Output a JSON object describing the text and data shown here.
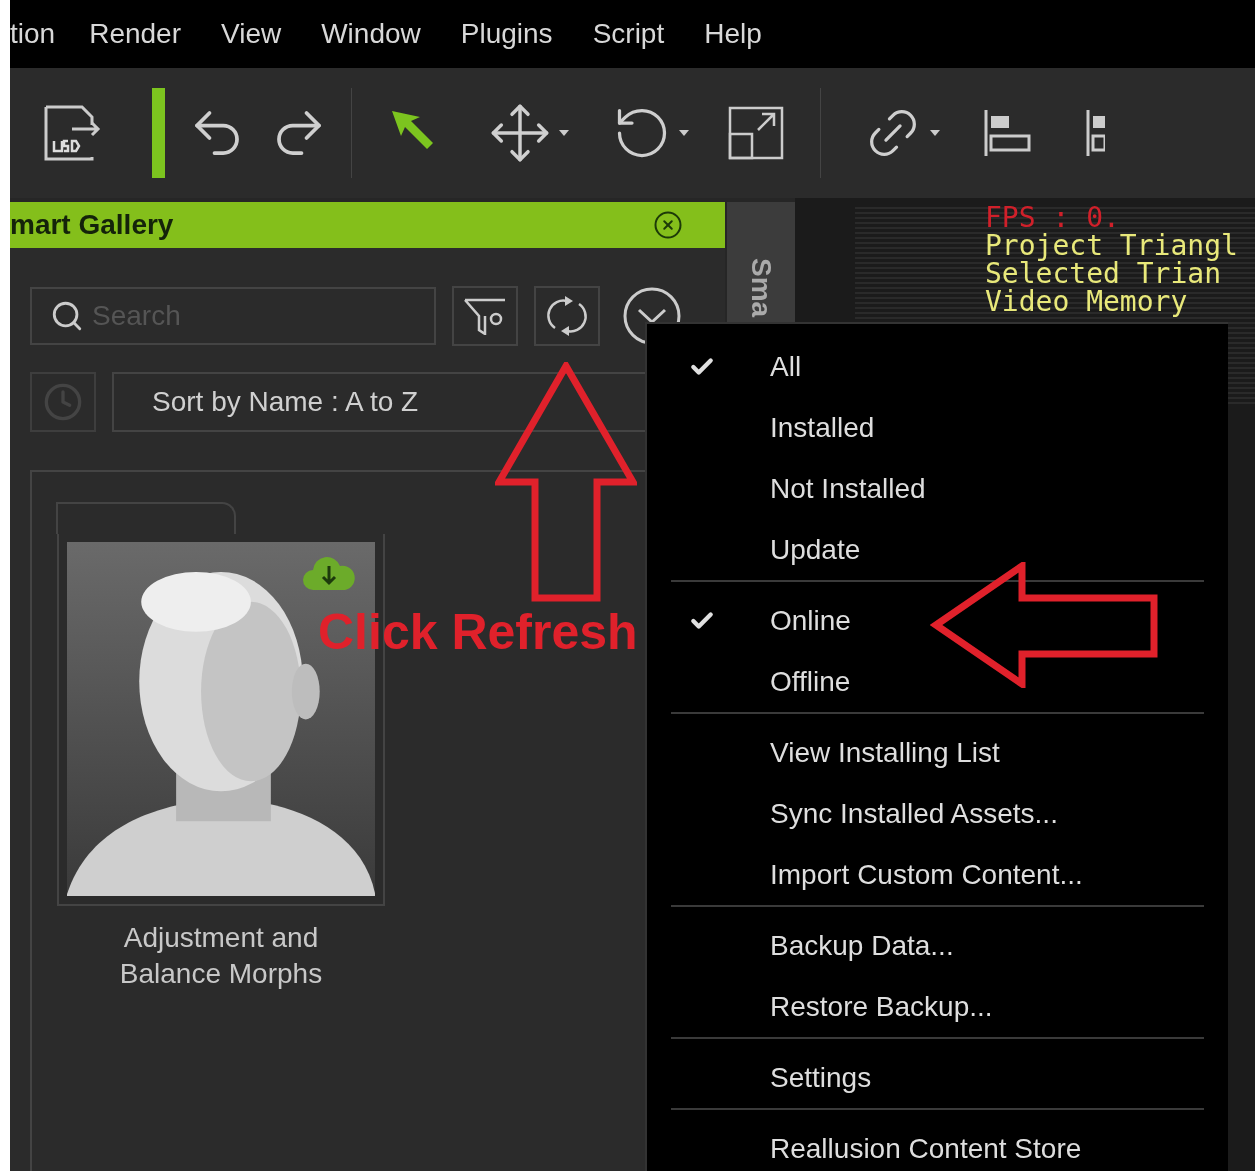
{
  "menu_bar": {
    "items": [
      "tion",
      "Render",
      "View",
      "Window",
      "Plugins",
      "Script",
      "Help"
    ]
  },
  "gallery": {
    "title": "mart Gallery",
    "search": {
      "placeholder": "Search"
    },
    "sort": {
      "value": "Sort by Name : A to Z"
    },
    "items": [
      {
        "kind": "picture",
        "caption": "Adjustment and Balance Morphs"
      }
    ]
  },
  "side_tab": {
    "label": "Sma"
  },
  "viewport": {
    "stats": [
      {
        "text": "FPS : 0.",
        "color": "#d0202a"
      },
      {
        "text": "Project Triangl",
        "color": "#e8e87a"
      },
      {
        "text": "Selected Trian",
        "color": "#e8e87a"
      },
      {
        "text": "Video Memory",
        "color": "#e8e87a"
      }
    ]
  },
  "dropdown_menu": {
    "groups": [
      [
        {
          "label": "All",
          "checked": true
        },
        {
          "label": "Installed",
          "checked": false
        },
        {
          "label": "Not Installed",
          "checked": false
        },
        {
          "label": "Update",
          "checked": false
        }
      ],
      [
        {
          "label": "Online",
          "checked": true
        },
        {
          "label": "Offline",
          "checked": false
        }
      ],
      [
        {
          "label": "View Installing List",
          "checked": false
        },
        {
          "label": "Sync Installed Assets...",
          "checked": false
        },
        {
          "label": "Import Custom Content...",
          "checked": false
        }
      ],
      [
        {
          "label": "Backup Data...",
          "checked": false
        },
        {
          "label": "Restore Backup...",
          "checked": false
        }
      ],
      [
        {
          "label": "Settings",
          "checked": false
        }
      ],
      [
        {
          "label": "Reallusion Content Store",
          "checked": false
        }
      ]
    ]
  },
  "annotation": {
    "text": "Click Refresh"
  }
}
